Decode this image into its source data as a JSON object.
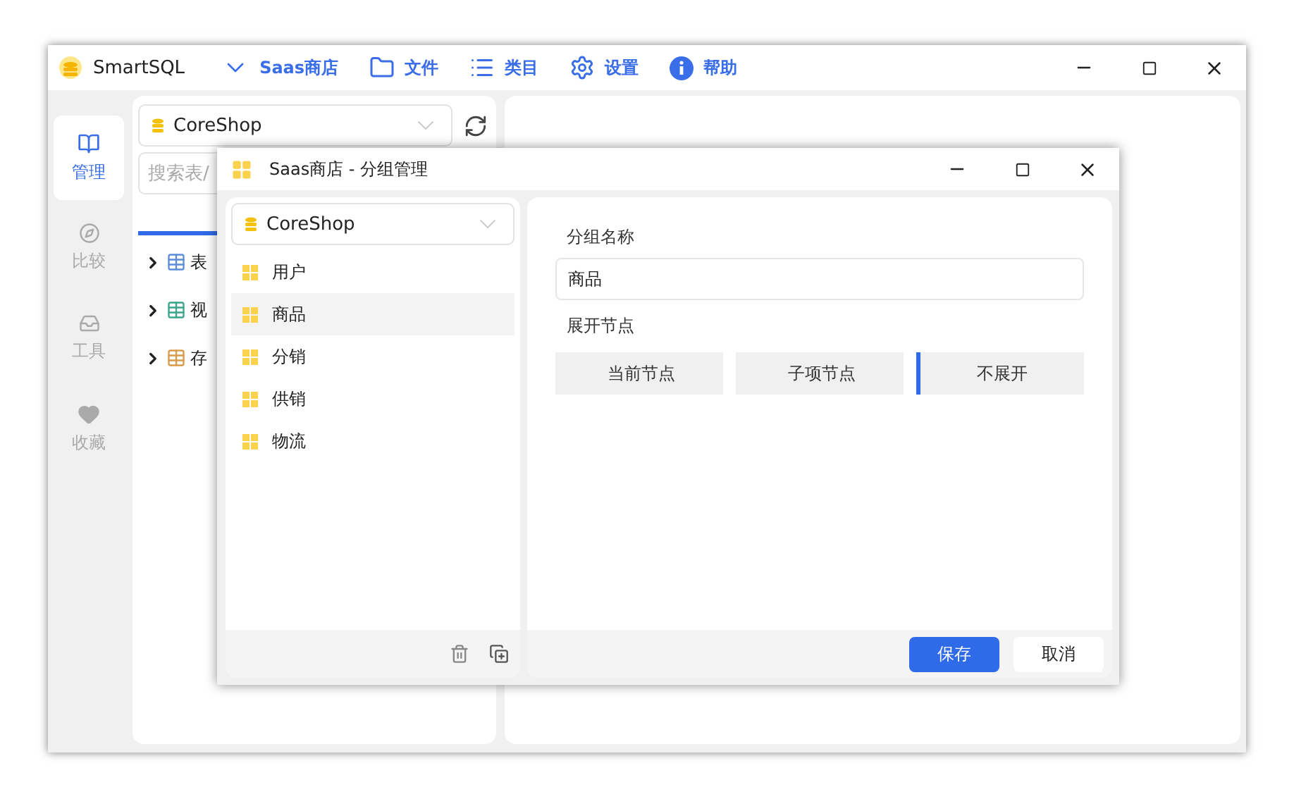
{
  "window": {
    "title": "SmartSQL"
  },
  "menu": [
    {
      "label": "Saas商店",
      "kind": "dropdown"
    },
    {
      "label": "文件",
      "kind": "folder"
    },
    {
      "label": "类目",
      "kind": "list"
    },
    {
      "label": "设置",
      "kind": "gear"
    },
    {
      "label": "帮助",
      "kind": "info"
    }
  ],
  "nav": [
    {
      "label": "管理",
      "selected": true,
      "kind": "book"
    },
    {
      "label": "比较",
      "selected": false,
      "kind": "compass"
    },
    {
      "label": "工具",
      "selected": false,
      "kind": "tray"
    },
    {
      "label": "收藏",
      "selected": false,
      "kind": "heart"
    }
  ],
  "database_select": {
    "value": "CoreShop"
  },
  "search": {
    "placeholder": "搜索表/"
  },
  "tree": [
    {
      "label": "表",
      "kind": "table"
    },
    {
      "label": "视",
      "kind": "view"
    },
    {
      "label": "存",
      "kind": "proc"
    }
  ],
  "dialog": {
    "title": "Saas商店 - 分组管理",
    "database_select": {
      "value": "CoreShop"
    },
    "groups": [
      {
        "label": "用户",
        "selected": false
      },
      {
        "label": "商品",
        "selected": true
      },
      {
        "label": "分销",
        "selected": false
      },
      {
        "label": "供销",
        "selected": false
      },
      {
        "label": "物流",
        "selected": false
      }
    ],
    "name_label": "分组名称",
    "name_value": "商品",
    "expand_label": "展开节点",
    "expand_options": [
      {
        "label": "当前节点",
        "selected": false
      },
      {
        "label": "子项节点",
        "selected": false
      },
      {
        "label": "不展开",
        "selected": true
      }
    ],
    "buttons": [
      {
        "label": "保存",
        "kind": "primary"
      },
      {
        "label": "取消",
        "kind": "secondary"
      }
    ]
  }
}
